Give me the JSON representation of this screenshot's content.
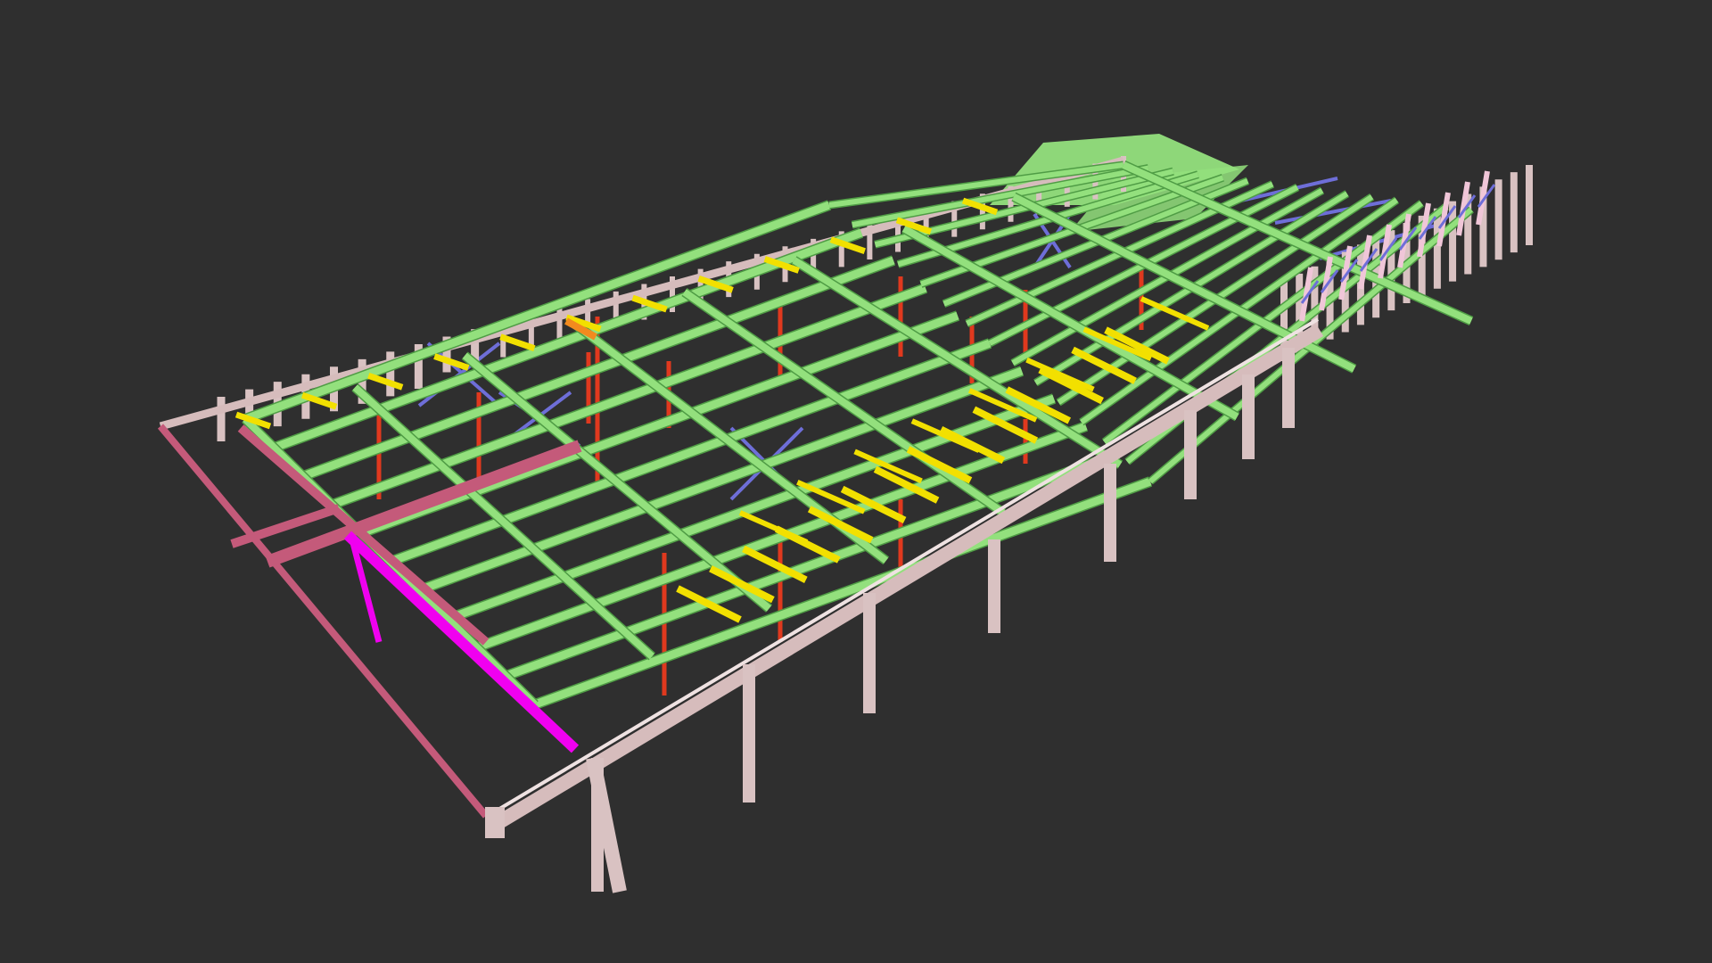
{
  "viewer": {
    "background_color": "#2f2f2f"
  },
  "model": {
    "colors": {
      "concrete_column": "#d9c2c2",
      "concrete_beam": "#d6bcbc",
      "main_beam": "#93e07d",
      "main_beam_edge": "#4f9c45",
      "secondary_beam": "#f2e000",
      "steel_column": "#e0391e",
      "bracing": "#6e6ed8",
      "edge_beam": "#c45a7a",
      "highlight_beam": "#f000f0",
      "roof_panel": "#93e07d",
      "accent_orange": "#f28a1e"
    }
  }
}
